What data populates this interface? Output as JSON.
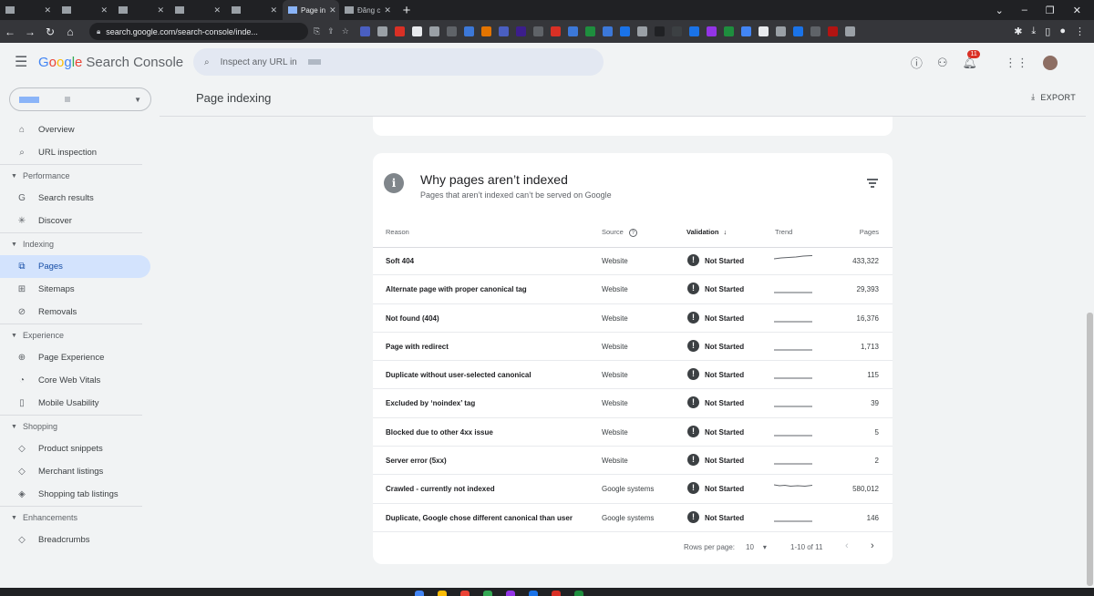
{
  "browser": {
    "tabs": [
      {
        "label": "",
        "active": false
      },
      {
        "label": "",
        "active": false
      },
      {
        "label": "",
        "active": false
      },
      {
        "label": "",
        "active": false
      },
      {
        "label": "",
        "active": false
      },
      {
        "label": "Page in",
        "active": true
      },
      {
        "label": "Đăng c",
        "active": false
      }
    ],
    "url": "search.google.com/search-console/inde...",
    "bookmark_colors": [
      "#4a5fc1",
      "#9aa0a6",
      "#d93025",
      "#e8eaed",
      "#9aa0a6",
      "#5f6368",
      "#3c78d8",
      "#e37400",
      "#4a5fc1",
      "#3c1e8c",
      "#5f6368",
      "#d93025",
      "#3c78d8",
      "#1e8e3e",
      "#3c78d8",
      "#1a73e8",
      "#9aa0a6",
      "#202124",
      "#3c4043",
      "#1a73e8",
      "#9334e6",
      "#1e8e3e",
      "#4285f4",
      "#e8eaed",
      "#9aa0a6",
      "#1a73e8",
      "#5f6368",
      "#b31412",
      "#9aa0a6"
    ]
  },
  "app": {
    "logo": {
      "google": "Google",
      "product": "Search Console"
    },
    "search_placeholder": "Inspect any URL in",
    "notification_count": "11"
  },
  "sidebar": {
    "property_dropdown": "",
    "items": [
      {
        "type": "item",
        "label": "Overview",
        "icon": "home-icon",
        "glyph": "⌂"
      },
      {
        "type": "item",
        "label": "URL inspection",
        "icon": "search-icon",
        "glyph": "⌕"
      },
      {
        "type": "section",
        "label": "Performance"
      },
      {
        "type": "item",
        "label": "Search results",
        "icon": "google-g-icon",
        "glyph": "G"
      },
      {
        "type": "item",
        "label": "Discover",
        "icon": "asterisk-icon",
        "glyph": "✳"
      },
      {
        "type": "section",
        "label": "Indexing"
      },
      {
        "type": "item",
        "label": "Pages",
        "icon": "pages-icon",
        "glyph": "⧉",
        "active": true
      },
      {
        "type": "item",
        "label": "Sitemaps",
        "icon": "sitemap-icon",
        "glyph": "⊞"
      },
      {
        "type": "item",
        "label": "Removals",
        "icon": "eye-off-icon",
        "glyph": "⊘"
      },
      {
        "type": "section",
        "label": "Experience"
      },
      {
        "type": "item",
        "label": "Page Experience",
        "icon": "plus-circle-icon",
        "glyph": "⊕"
      },
      {
        "type": "item",
        "label": "Core Web Vitals",
        "icon": "gauge-icon",
        "glyph": "◔"
      },
      {
        "type": "item",
        "label": "Mobile Usability",
        "icon": "phone-icon",
        "glyph": "▯"
      },
      {
        "type": "section",
        "label": "Shopping"
      },
      {
        "type": "item",
        "label": "Product snippets",
        "icon": "layers-icon",
        "glyph": "◇"
      },
      {
        "type": "item",
        "label": "Merchant listings",
        "icon": "layers-icon",
        "glyph": "◇"
      },
      {
        "type": "item",
        "label": "Shopping tab listings",
        "icon": "tag-icon",
        "glyph": "◈"
      },
      {
        "type": "section",
        "label": "Enhancements"
      },
      {
        "type": "item",
        "label": "Breadcrumbs",
        "icon": "layers-icon",
        "glyph": "◇"
      }
    ]
  },
  "main": {
    "page_title": "Page indexing",
    "export_label": "EXPORT",
    "card": {
      "title": "Why pages aren’t indexed",
      "subtitle": "Pages that aren’t indexed can’t be served on Google",
      "columns": {
        "reason": "Reason",
        "source": "Source",
        "validation": "Validation",
        "trend": "Trend",
        "pages": "Pages"
      },
      "rows": [
        {
          "reason": "Soft 404",
          "source": "Website",
          "validation": "Not Started",
          "trend": "rising",
          "pages": "433,322"
        },
        {
          "reason": "Alternate page with proper canonical tag",
          "source": "Website",
          "validation": "Not Started",
          "trend": "flat",
          "pages": "29,393"
        },
        {
          "reason": "Not found (404)",
          "source": "Website",
          "validation": "Not Started",
          "trend": "flat",
          "pages": "16,376"
        },
        {
          "reason": "Page with redirect",
          "source": "Website",
          "validation": "Not Started",
          "trend": "flat",
          "pages": "1,713"
        },
        {
          "reason": "Duplicate without user-selected canonical",
          "source": "Website",
          "validation": "Not Started",
          "trend": "flat",
          "pages": "115"
        },
        {
          "reason": "Excluded by ‘noindex’ tag",
          "source": "Website",
          "validation": "Not Started",
          "trend": "flat",
          "pages": "39"
        },
        {
          "reason": "Blocked due to other 4xx issue",
          "source": "Website",
          "validation": "Not Started",
          "trend": "flat",
          "pages": "5"
        },
        {
          "reason": "Server error (5xx)",
          "source": "Website",
          "validation": "Not Started",
          "trend": "flat",
          "pages": "2"
        },
        {
          "reason": "Crawled - currently not indexed",
          "source": "Google systems",
          "validation": "Not Started",
          "trend": "wavy",
          "pages": "580,012"
        },
        {
          "reason": "Duplicate, Google chose different canonical than user",
          "source": "Google systems",
          "validation": "Not Started",
          "trend": "flat",
          "pages": "146"
        }
      ],
      "pagination": {
        "rows_per_page_label": "Rows per page:",
        "rows_per_page": "10",
        "range": "1-10 of 11"
      }
    }
  }
}
